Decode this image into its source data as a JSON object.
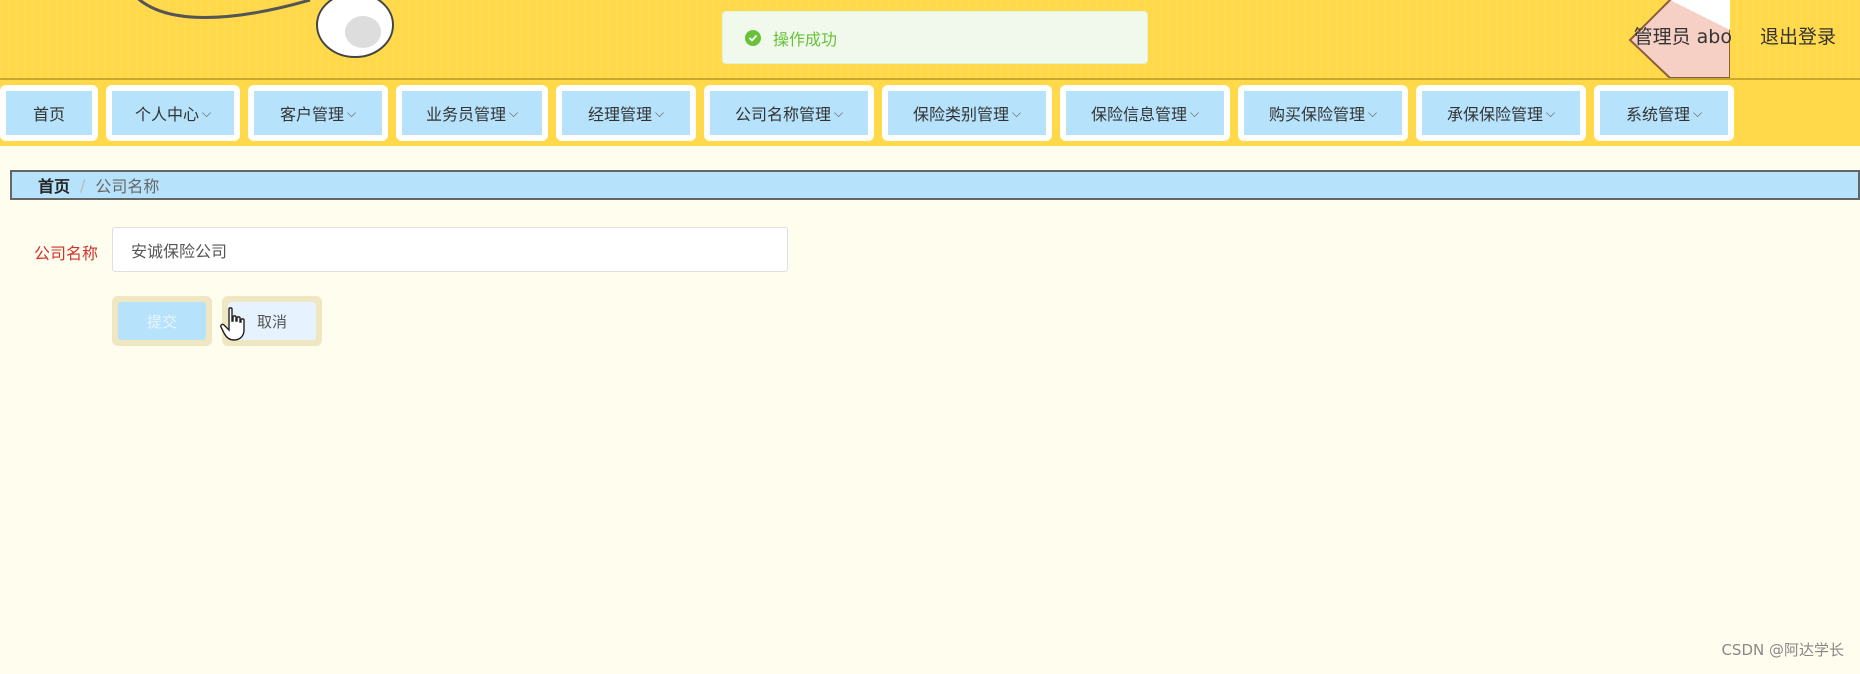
{
  "toast": {
    "message": "操作成功",
    "icon": "check-circle-icon"
  },
  "user": {
    "role_name": "管理员 abo",
    "logout": "退出登录"
  },
  "nav": [
    {
      "label": "首页",
      "dropdown": false
    },
    {
      "label": "个人中心",
      "dropdown": true
    },
    {
      "label": "客户管理",
      "dropdown": true
    },
    {
      "label": "业务员管理",
      "dropdown": true
    },
    {
      "label": "经理管理",
      "dropdown": true
    },
    {
      "label": "公司名称管理",
      "dropdown": true
    },
    {
      "label": "保险类别管理",
      "dropdown": true
    },
    {
      "label": "保险信息管理",
      "dropdown": true
    },
    {
      "label": "购买保险管理",
      "dropdown": true
    },
    {
      "label": "承保保险管理",
      "dropdown": true
    },
    {
      "label": "系统管理",
      "dropdown": true
    }
  ],
  "breadcrumb": {
    "home": "首页",
    "separator": "/",
    "current": "公司名称"
  },
  "form": {
    "label": "公司名称",
    "value": "安诚保险公司",
    "submit": "提交",
    "cancel": "取消"
  },
  "watermark": "CSDN @阿达学长",
  "colors": {
    "header_bg": "#ffd94a",
    "nav_item_bg": "#b6e3fb",
    "page_bg": "#fffdee",
    "success": "#67c23a",
    "label_red": "#d0332b"
  }
}
